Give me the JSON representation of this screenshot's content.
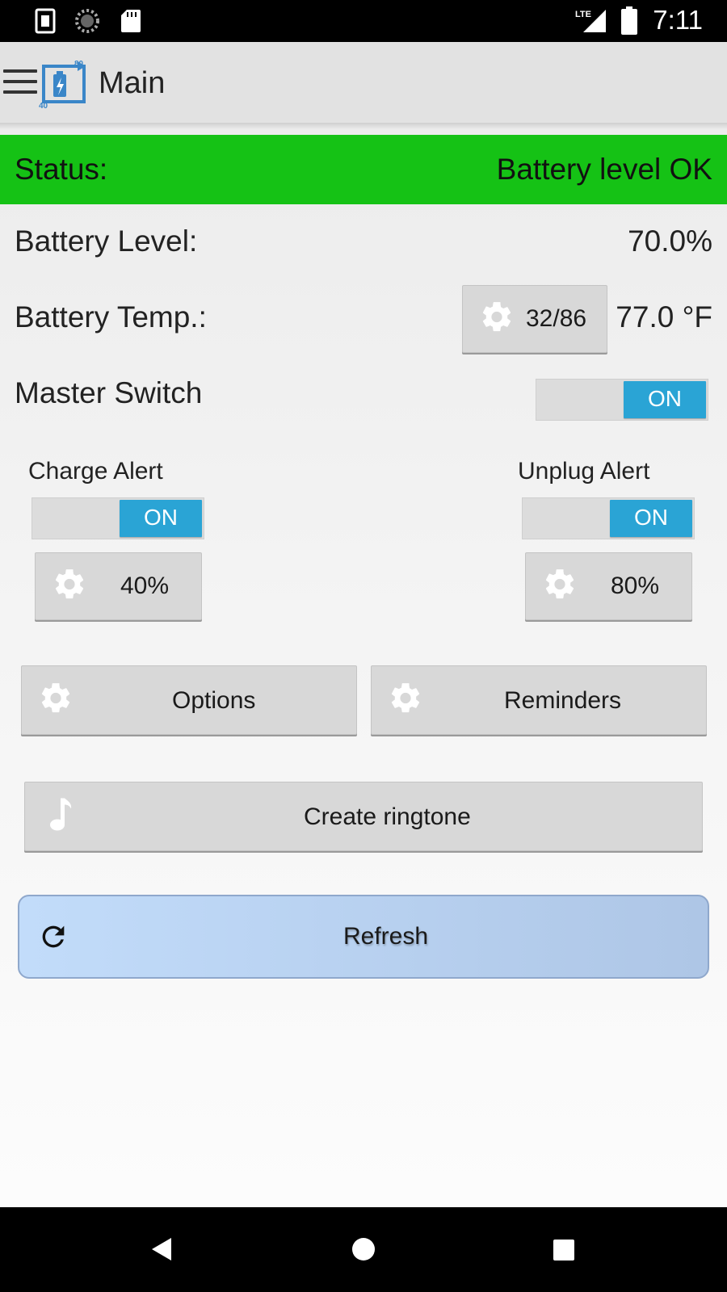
{
  "statusbar": {
    "time": "7:11",
    "network_label": "LTE",
    "icons": [
      "screenshot-icon",
      "sync-icon",
      "sd-card-icon",
      "lte-signal-icon",
      "battery-icon"
    ]
  },
  "appbar": {
    "title": "Main",
    "logo_numbers": {
      "top": "80",
      "bottom": "40"
    }
  },
  "status": {
    "label": "Status:",
    "value": "Battery level OK",
    "color": "#15c215"
  },
  "battery_level": {
    "label": "Battery Level:",
    "value": "70.0%"
  },
  "battery_temp": {
    "label": "Battery Temp.:",
    "range_button": "32/86",
    "value": "77.0 °F"
  },
  "master_switch": {
    "label": "Master Switch",
    "state": "ON"
  },
  "charge_alert": {
    "label": "Charge Alert",
    "toggle": "ON",
    "level_button": "40%"
  },
  "unplug_alert": {
    "label": "Unplug Alert",
    "toggle": "ON",
    "level_button": "80%"
  },
  "buttons": {
    "options": "Options",
    "reminders": "Reminders",
    "create_ringtone": "Create ringtone",
    "refresh": "Refresh"
  },
  "colors": {
    "accent": "#2aa4d5",
    "status_ok": "#15c215",
    "refresh_bg": "#c2dcfa"
  },
  "navbar": {
    "icons": [
      "back-icon",
      "home-icon",
      "recents-icon"
    ]
  }
}
